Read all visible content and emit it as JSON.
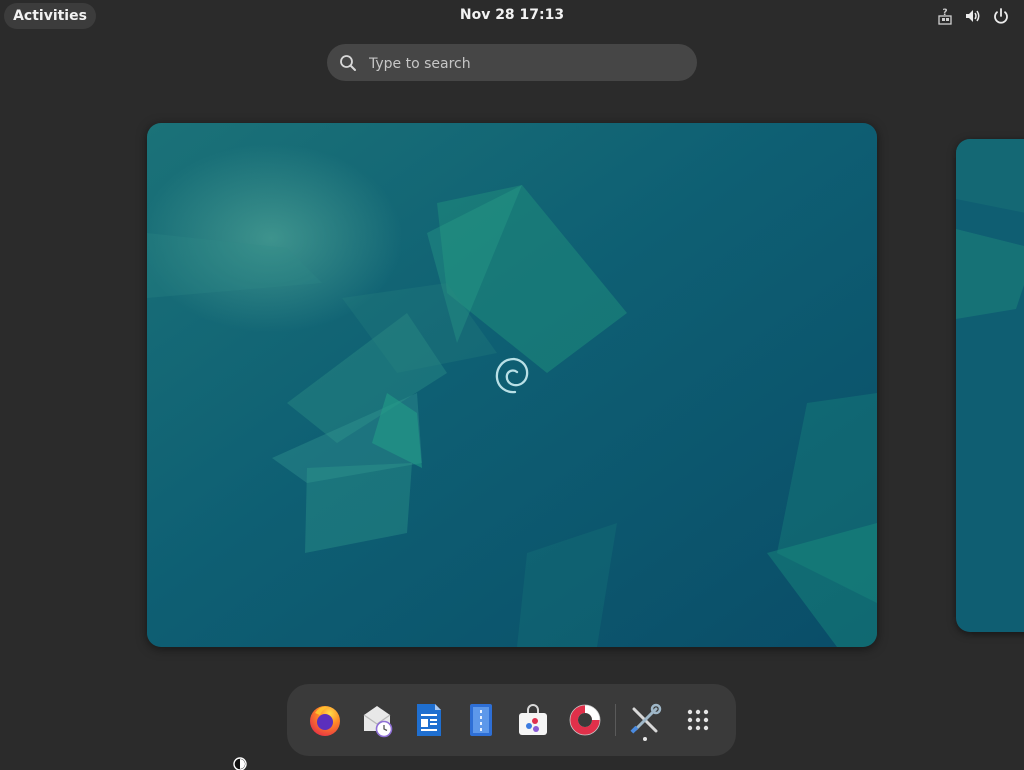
{
  "topbar": {
    "activities_label": "Activities",
    "clock": "Nov 28  17:13",
    "tray_icons": [
      "accessibility-network-icon",
      "volume-icon",
      "power-icon"
    ]
  },
  "search": {
    "placeholder": "Type to search",
    "icon": "search-icon"
  },
  "workspaces": {
    "current": "workspace-1",
    "wallpaper_colors": {
      "base": "#0d5770",
      "dark": "#0a4d66",
      "accent": "#1f8c7c",
      "highlight": "#2ba38a"
    }
  },
  "dash": {
    "apps": [
      {
        "name": "Firefox",
        "icon": "firefox-icon",
        "running": false
      },
      {
        "name": "Evolution",
        "icon": "mail-clock-icon",
        "running": false
      },
      {
        "name": "LibreOffice Writer",
        "icon": "writer-document-icon",
        "running": false
      },
      {
        "name": "Text Editor",
        "icon": "text-editor-icon",
        "running": false
      },
      {
        "name": "Software",
        "icon": "software-bag-icon",
        "running": false
      },
      {
        "name": "Help",
        "icon": "lifebuoy-icon",
        "running": false
      },
      {
        "name": "Tweaks",
        "icon": "tools-icon",
        "running": true
      },
      {
        "name": "Show Applications",
        "icon": "app-grid-icon",
        "running": false
      }
    ]
  }
}
